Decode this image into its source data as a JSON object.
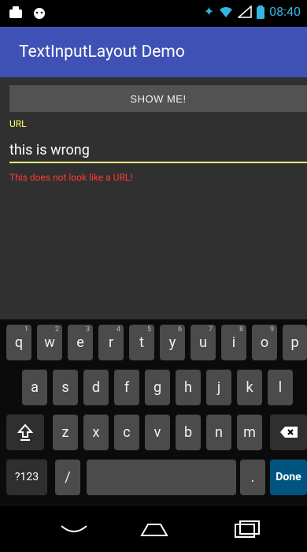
{
  "status_bar": {
    "time": "08:40"
  },
  "app": {
    "title": "TextInputLayout Demo"
  },
  "form": {
    "button_label": "SHOW ME!",
    "hint": "URL",
    "value": "this is wrong",
    "error": "This does not look like a URL!"
  },
  "keyboard": {
    "row1": [
      {
        "key": "q",
        "hint": "1"
      },
      {
        "key": "w",
        "hint": "2"
      },
      {
        "key": "e",
        "hint": "3"
      },
      {
        "key": "r",
        "hint": "4"
      },
      {
        "key": "t",
        "hint": "5"
      },
      {
        "key": "y",
        "hint": "6"
      },
      {
        "key": "u",
        "hint": "7"
      },
      {
        "key": "i",
        "hint": "8"
      },
      {
        "key": "o",
        "hint": "9"
      },
      {
        "key": "p",
        "hint": ""
      }
    ],
    "row2": [
      "a",
      "s",
      "d",
      "f",
      "g",
      "h",
      "j",
      "k",
      "l"
    ],
    "row3": [
      "z",
      "x",
      "c",
      "v",
      "b",
      "n",
      "m"
    ],
    "sym": "?123",
    "slash": "/",
    "period": ".",
    "done": "Done"
  },
  "colors": {
    "app_bar": "#3f51b5",
    "accent": "#ffff66",
    "error": "#ff3b2f"
  }
}
